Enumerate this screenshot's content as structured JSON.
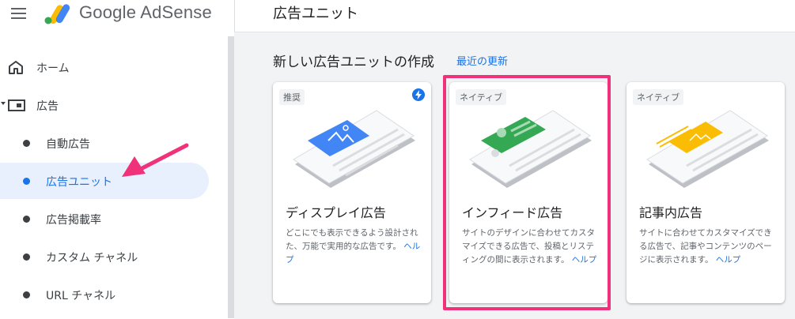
{
  "app": {
    "brand": "Google AdSense",
    "page_title": "広告ユニット"
  },
  "sidebar": {
    "items": [
      {
        "label": "ホーム",
        "icon": "home-icon"
      },
      {
        "label": "広告",
        "icon": "ad-unit-icon"
      },
      {
        "label": "自動広告"
      },
      {
        "label": "広告ユニット",
        "active": true
      },
      {
        "label": "広告掲載率"
      },
      {
        "label": "カスタム チャネル"
      },
      {
        "label": "URL チャネル"
      }
    ]
  },
  "main": {
    "section_title": "新しい広告ユニットの作成",
    "section_link": "最近の更新",
    "cards": [
      {
        "badge": "推奨",
        "title": "ディスプレイ広告",
        "desc": "どこにでも表示できるよう設計された、万能で実用的な広告です。",
        "help": "ヘルプ",
        "accent": "#4285f4"
      },
      {
        "badge": "ネイティブ",
        "title": "インフィード広告",
        "desc": "サイトのデザインに合わせてカスタマイズできる広告で、投稿とリスティングの間に表示されます。",
        "help": "ヘルプ",
        "accent": "#34a853"
      },
      {
        "badge": "ネイティブ",
        "title": "記事内広告",
        "desc": "サイトに合わせてカスタマイズできる広告で、記事やコンテンツのページに表示されます。",
        "help": "ヘルプ",
        "accent": "#fbbc04"
      }
    ]
  },
  "colors": {
    "accent_blue": "#1a73e8",
    "highlight_pink": "#f0327a",
    "active_bg": "#e8f0fe"
  }
}
